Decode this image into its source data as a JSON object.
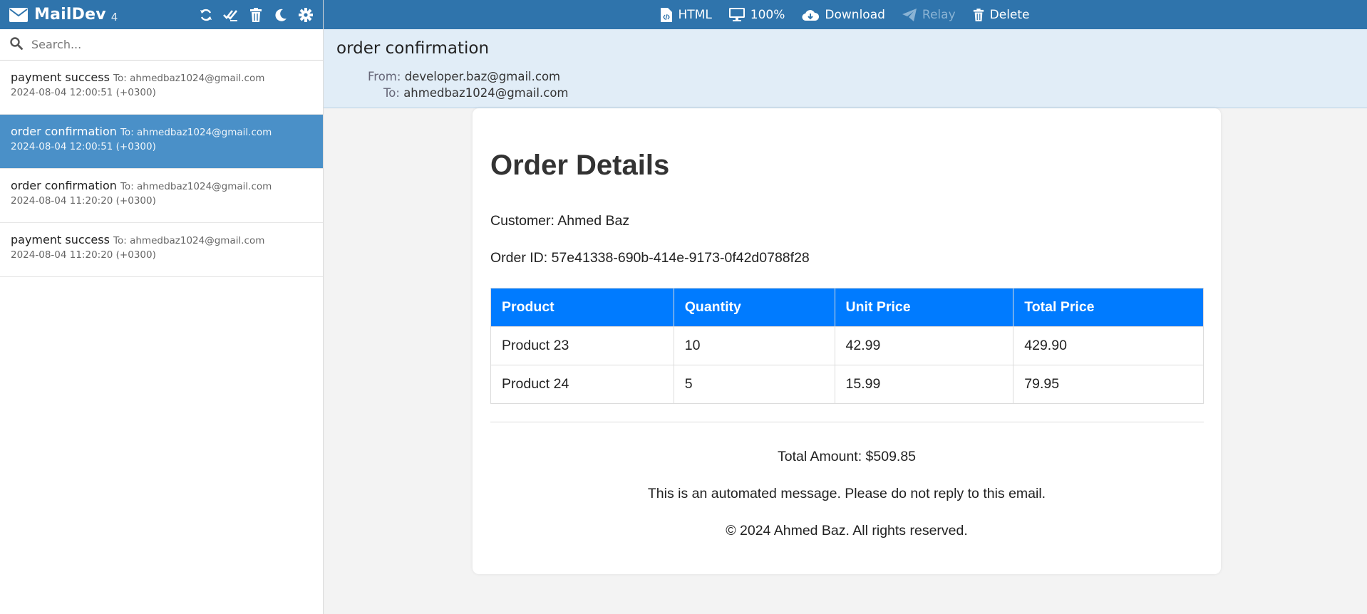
{
  "app": {
    "name": "MailDev",
    "count": "4"
  },
  "search": {
    "placeholder": "Search..."
  },
  "sidebar": {
    "tools": [
      "refresh-icon",
      "mark-all-read-icon",
      "trash-icon",
      "moon-icon",
      "gear-icon"
    ],
    "items": [
      {
        "subject": "payment success",
        "to": "To: ahmedbaz1024@gmail.com",
        "date": "2024-08-04 12:00:51 (+0300)",
        "active": false
      },
      {
        "subject": "order confirmation",
        "to": "To: ahmedbaz1024@gmail.com",
        "date": "2024-08-04 12:00:51 (+0300)",
        "active": true
      },
      {
        "subject": "order confirmation",
        "to": "To: ahmedbaz1024@gmail.com",
        "date": "2024-08-04 11:20:20 (+0300)",
        "active": false
      },
      {
        "subject": "payment success",
        "to": "To: ahmedbaz1024@gmail.com",
        "date": "2024-08-04 11:20:20 (+0300)",
        "active": false
      }
    ]
  },
  "toolbar": {
    "html_label": "HTML",
    "zoom_label": "100%",
    "download_label": "Download",
    "relay_label": "Relay",
    "delete_label": "Delete"
  },
  "mail": {
    "subject": "order confirmation",
    "from_label": "From:",
    "from": "developer.baz@gmail.com",
    "to_label": "To:",
    "to": "ahmedbaz1024@gmail.com"
  },
  "email_body": {
    "title": "Order Details",
    "customer": "Customer: Ahmed Baz",
    "order_id": "Order ID: 57e41338-690b-414e-9173-0f42d0788f28",
    "table": {
      "headers": [
        "Product",
        "Quantity",
        "Unit Price",
        "Total Price"
      ],
      "rows": [
        [
          "Product 23",
          "10",
          "42.99",
          "429.90"
        ],
        [
          "Product 24",
          "5",
          "15.99",
          "79.95"
        ]
      ]
    },
    "total": "Total Amount: $509.85",
    "notice": "This is an automated message. Please do not reply to this email.",
    "copyright": "© 2024 Ahmed Baz. All rights reserved."
  },
  "colors": {
    "header_blue": "#2f74ac",
    "selected_item": "#4a90c8",
    "table_header": "#007bff",
    "mail_head_bg": "#e1edf7"
  }
}
